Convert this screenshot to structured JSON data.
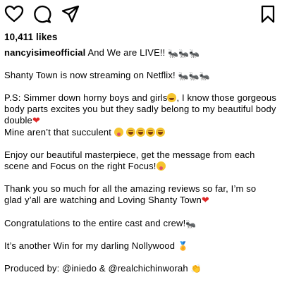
{
  "post": {
    "likes": "10,411 likes",
    "username": "nancyisimeofficial",
    "caption": {
      "line1": "And We are LIVE!!",
      "line2": "Shanty Town is now streaming on Netflix!",
      "line3a": "P.S: Simmer down horny boys and girls",
      "line3b": ", I know those gorgeous body parts excites you but they sadly belong to my beautiful body double",
      "line3c": "Mine aren’t that succulent",
      "line4": "Enjoy our beautiful masterpiece, get the message from each scene and Focus on the right Focus!",
      "line5": "Thank you so much for all the amazing reviews so far, I’m so glad y’all are watching and Loving Shanty Town",
      "line6": "Congratulations to the entire cast and crew!",
      "line7": "It’s another Win for my darling Nollywood",
      "produced_label": "Produced by:",
      "mention1": "@iniedo",
      "amp": "&",
      "mention2": "@realchichinworah"
    }
  },
  "icons": {
    "like": "heart-outline-icon",
    "comment": "comment-bubble-icon",
    "share": "paper-plane-icon",
    "save": "bookmark-icon",
    "ant": "ant-emoji",
    "laugh": "laughing-emoji",
    "tongue": "tongue-out-emoji",
    "grin": "grinning-emoji",
    "heart": "red-heart-emoji",
    "medal": "medal-emoji",
    "clap": "clapping-emoji"
  }
}
